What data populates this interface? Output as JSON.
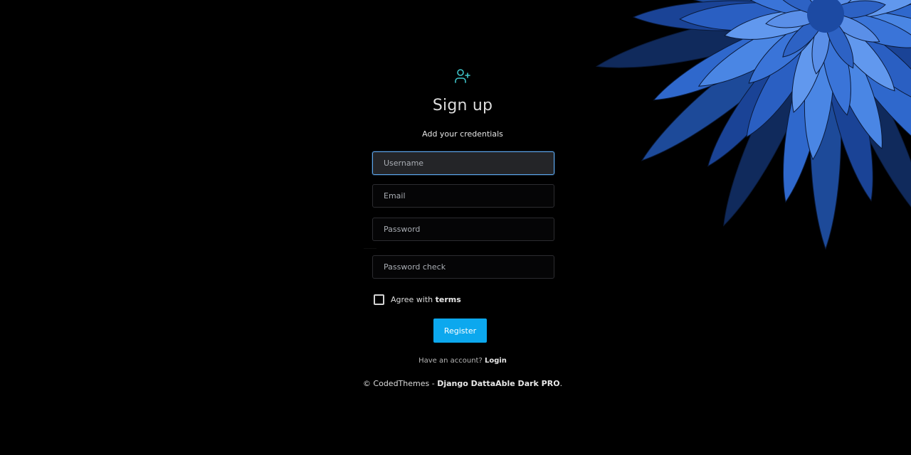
{
  "header": {
    "icon": "user-plus-icon",
    "title": "Sign up",
    "subtitle": "Add your credentials"
  },
  "form": {
    "username": {
      "placeholder": "Username",
      "value": ""
    },
    "email": {
      "placeholder": "Email",
      "value": ""
    },
    "password": {
      "placeholder": "Password",
      "value": ""
    },
    "password_hint": "………",
    "password_check": {
      "placeholder": "Password check",
      "value": ""
    },
    "agree_prefix": "Agree with ",
    "agree_terms": "terms",
    "register_label": "Register"
  },
  "account": {
    "prompt": "Have an account? ",
    "login_label": "Login"
  },
  "footer": {
    "prefix": "© CodedThemes - ",
    "product": "Django DattaAble Dark PRO",
    "suffix": "."
  },
  "colors": {
    "accent": "#0ca8ee",
    "icon": "#3ec3c9",
    "focus_border": "#5ca5ea",
    "background": "#000000",
    "flower": "#3b7de0"
  }
}
